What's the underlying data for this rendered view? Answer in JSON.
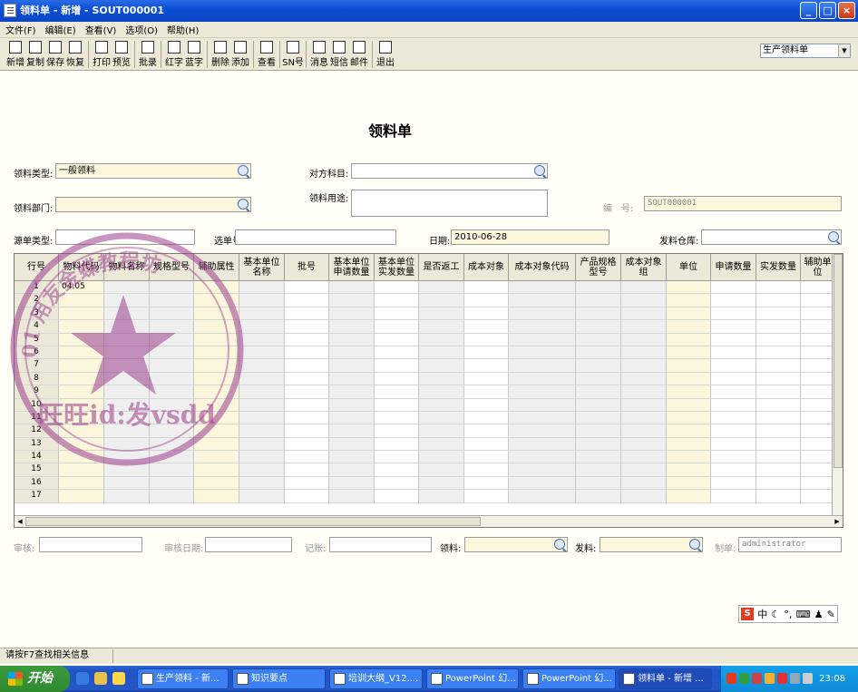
{
  "window": {
    "title": "领料单 - 新增 - SOUT000001",
    "min": "_",
    "max": "□",
    "close": "×"
  },
  "menu": [
    "文件(F)",
    "编辑(E)",
    "查看(V)",
    "选项(O)",
    "帮助(H)"
  ],
  "toolbar": [
    {
      "label": "新增",
      "icon": "new-icon"
    },
    {
      "label": "复制",
      "icon": "copy-icon"
    },
    {
      "label": "保存",
      "icon": "save-icon"
    },
    {
      "label": "恢复",
      "icon": "undo-icon"
    },
    {
      "sep": true
    },
    {
      "label": "打印",
      "icon": "print-icon"
    },
    {
      "label": "预览",
      "icon": "preview-icon"
    },
    {
      "sep": true
    },
    {
      "label": "批录",
      "icon": "batch-icon"
    },
    {
      "sep": true
    },
    {
      "label": "红字",
      "icon": "red-word-icon"
    },
    {
      "label": "蓝字",
      "icon": "blue-word-icon"
    },
    {
      "sep": true
    },
    {
      "label": "删除",
      "icon": "delete-row-icon"
    },
    {
      "label": "添加",
      "icon": "add-row-icon"
    },
    {
      "sep": true
    },
    {
      "label": "查看",
      "icon": "view-icon"
    },
    {
      "sep": true
    },
    {
      "label": "SN号",
      "icon": "sn-icon"
    },
    {
      "sep": true
    },
    {
      "label": "消息",
      "icon": "message-icon"
    },
    {
      "label": "短信",
      "icon": "sms-icon"
    },
    {
      "label": "邮件",
      "icon": "mail-icon"
    },
    {
      "sep": true
    },
    {
      "label": "退出",
      "icon": "exit-icon"
    }
  ],
  "doc_type_select": "生产领料单",
  "form_title": "领料单",
  "fields": {
    "pick_type_label": "领料类型:",
    "pick_type_value": "一般领料",
    "counter_subject_label": "对方科目:",
    "counter_subject_value": "",
    "dept_label": "领料部门:",
    "dept_value": "",
    "purpose_label": "领料用途:",
    "purpose_value": "",
    "number_label": "编　号:",
    "number_value": "SOUT000001",
    "source_type_label": "源单类型:",
    "source_type_value": "",
    "select_no_label": "选单号:",
    "select_no_value": "",
    "date_label": "日期:",
    "date_value": "2010-06-28",
    "warehouse_label": "发料仓库:",
    "warehouse_value": ""
  },
  "table": {
    "headers": [
      "行号",
      "物料代码",
      "物料名称",
      "规格型号",
      "辅助属性",
      "基本单位名称",
      "批号",
      "基本单位申请数量",
      "基本单位实发数量",
      "是否返工",
      "成本对象",
      "成本对象代码",
      "产品规格型号",
      "成本对象组",
      "单位",
      "申请数量",
      "实发数量",
      "辅助单位"
    ],
    "rows": [
      [
        "1",
        "04.05"
      ],
      [
        "2",
        ""
      ],
      [
        "3",
        ""
      ],
      [
        "4",
        ""
      ],
      [
        "5",
        ""
      ],
      [
        "6",
        ""
      ],
      [
        "7",
        ""
      ],
      [
        "8",
        ""
      ],
      [
        "9",
        ""
      ],
      [
        "10",
        ""
      ],
      [
        "11",
        ""
      ],
      [
        "12",
        ""
      ],
      [
        "13",
        ""
      ],
      [
        "14",
        ""
      ],
      [
        "15",
        ""
      ],
      [
        "16",
        ""
      ],
      [
        "17",
        ""
      ]
    ]
  },
  "footer": {
    "audit_label": "审核:",
    "audit_value": "",
    "audit_date_label": "审核日期:",
    "audit_date_value": "",
    "post_label": "记账:",
    "post_value": "",
    "picker_label": "领料:",
    "picker_value": "",
    "issuer_label": "发料:",
    "issuer_value": "",
    "maker_label": "制单:",
    "maker_value": "administrator"
  },
  "status_text": "请按F7查找相关信息",
  "watermark": {
    "text_bottom": "旺旺id:发vsdd",
    "text_top": "01 用友金蝶教程坊"
  },
  "ime_text": "中",
  "taskbar": {
    "start": "开始",
    "tasks": [
      "生产领料 - 新...",
      "知识要点",
      "培训大纲_V12....",
      "PowerPoint 幻...",
      "PowerPoint 幻...",
      "领料单 - 新增 ..."
    ],
    "clock": "23:08"
  },
  "colors": {
    "accent_yellow": "#fbf6dc",
    "title_blue": "#0b4fd6",
    "stamp": "#9b3c8c"
  }
}
